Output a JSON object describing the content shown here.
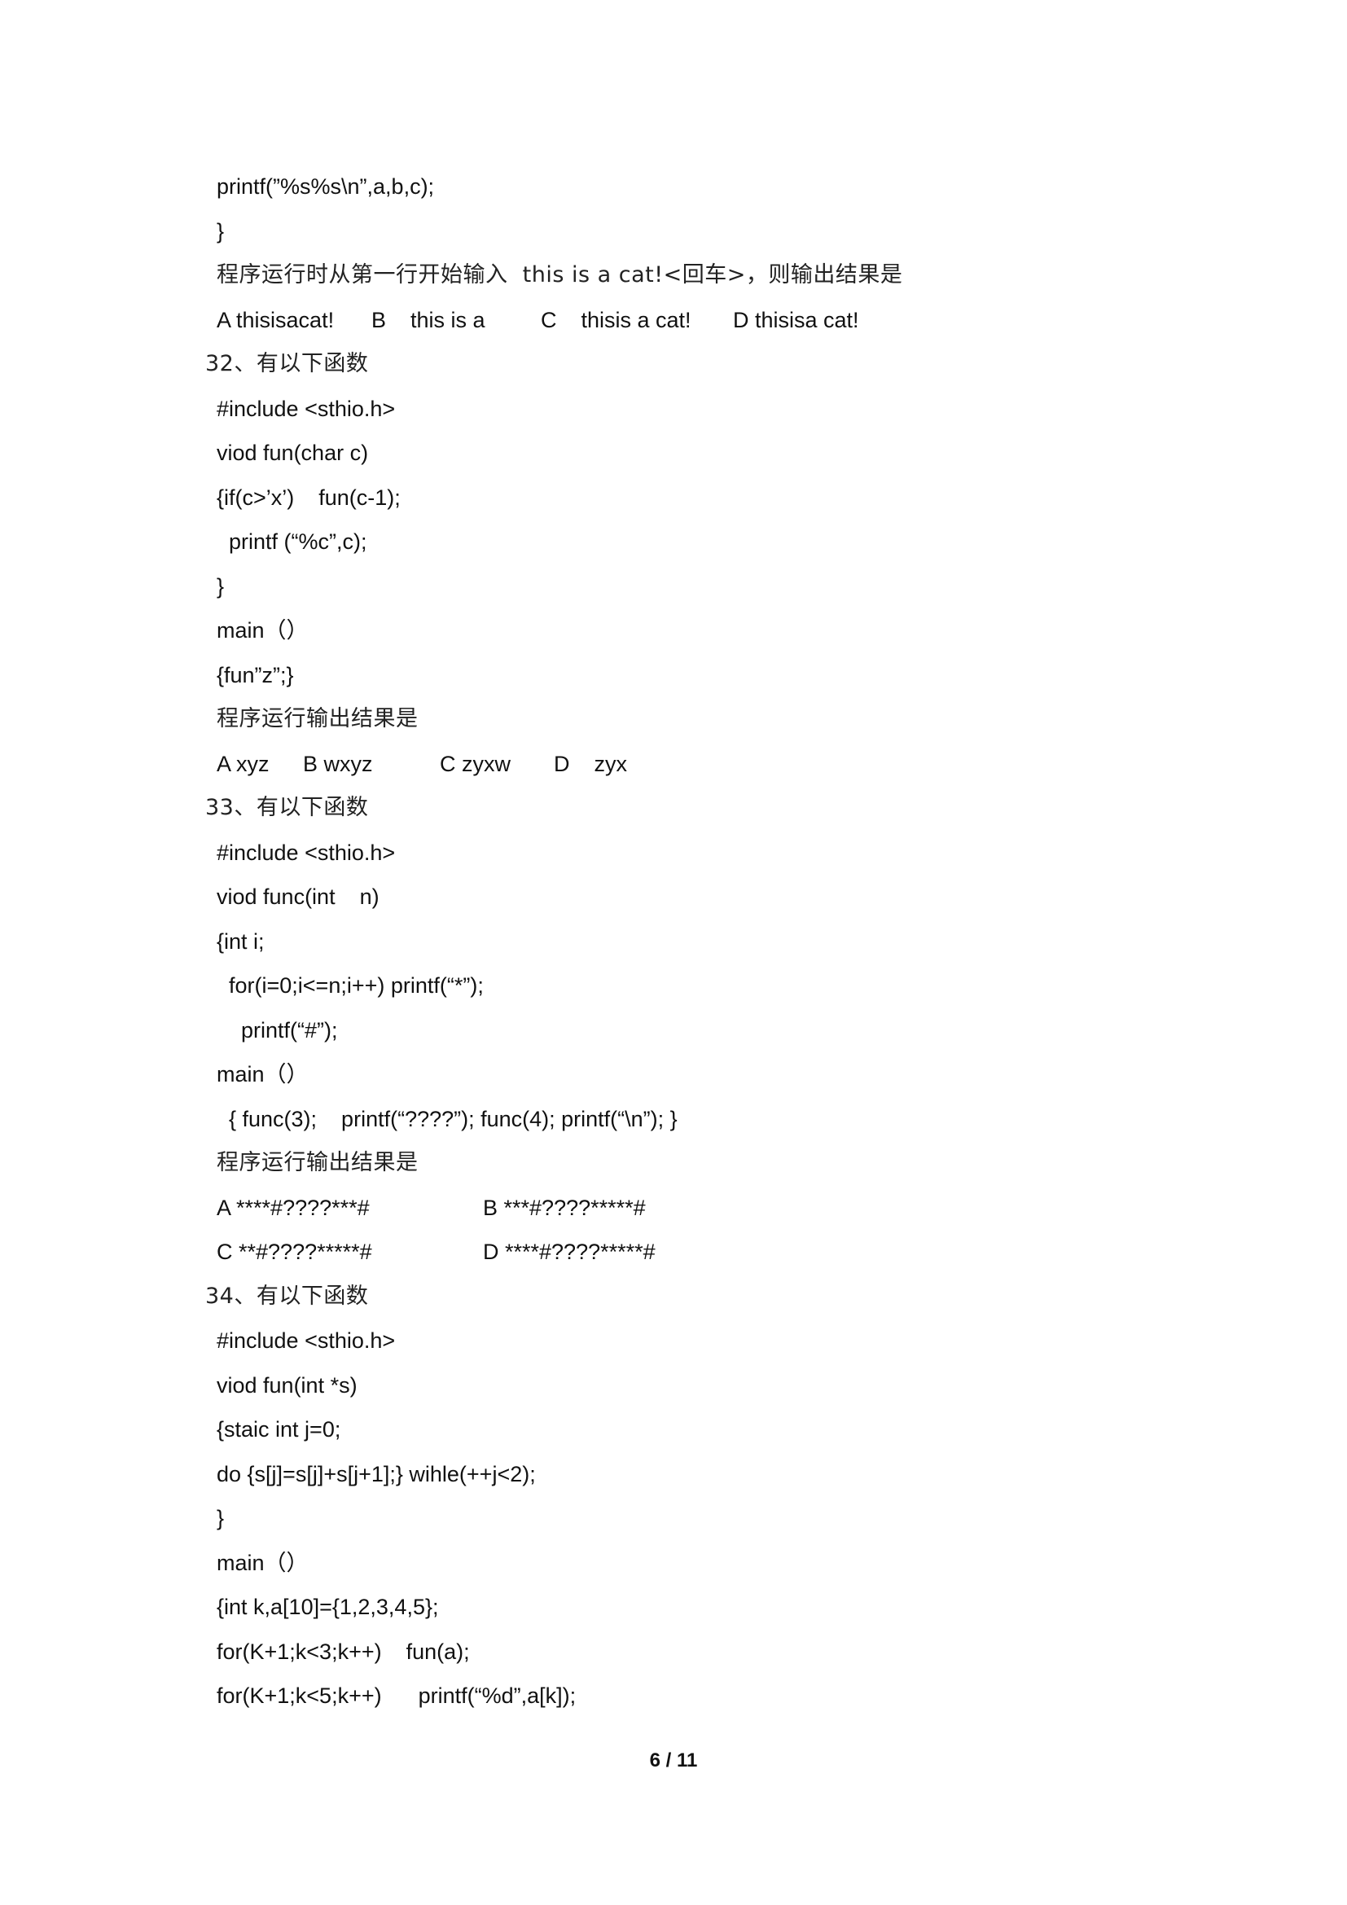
{
  "page": {
    "number_label": "6 / 11"
  },
  "lines": [
    {
      "text": "printf(”%s%s\\n”,a,b,c);"
    },
    {
      "text": "}"
    },
    {
      "text": "程序运行时从第一行开始输入  this is a cat!<回车>，则输出结果是"
    },
    {
      "options": [
        "A thisisacat!",
        "B    this is a",
        "C    thisis a cat!",
        "D thisisa cat!"
      ]
    },
    {
      "text": "32、有以下函数"
    },
    {
      "text": "#include <sthio.h>"
    },
    {
      "text": "viod fun(char c)"
    },
    {
      "text": "{if(c>’x’)    fun(c-1);"
    },
    {
      "text": "printf (“%c”,c);"
    },
    {
      "text": "}"
    },
    {
      "text": "main（）"
    },
    {
      "text": "{fun”z”;}"
    },
    {
      "text": "程序运行输出结果是"
    },
    {
      "options": [
        "A xyz",
        "B wxyz",
        "C zyxw",
        "D    zyx"
      ]
    },
    {
      "text": "33、有以下函数"
    },
    {
      "text": "#include <sthio.h>"
    },
    {
      "text": "viod func(int    n)"
    },
    {
      "text": "{int i;"
    },
    {
      "text": "for(i=0;i<=n;i++) printf(“*”);"
    },
    {
      "text": "printf(“#”);"
    },
    {
      "text": "main（）"
    },
    {
      "text": "{ func(3);    printf(“????”); func(4); printf(“\\n”); }"
    },
    {
      "text": "程序运行输出结果是"
    },
    {
      "options": [
        "A ****#????***#",
        "B ***#????*****#"
      ]
    },
    {
      "options": [
        "C **#????*****#",
        "D ****#????*****#"
      ]
    },
    {
      "text": "34、有以下函数"
    },
    {
      "text": "#include <sthio.h>"
    },
    {
      "text": "viod fun(int *s)"
    },
    {
      "text": "{staic int j=0;"
    },
    {
      "text": "do {s[j]=s[j]+s[j+1];} wihle(++j<2);"
    },
    {
      "text": "}"
    },
    {
      "text": "main（）"
    },
    {
      "text": "{int k,a[10]={1,2,3,4,5};"
    },
    {
      "text": "for(K+1;k<3;k++)    fun(a);"
    },
    {
      "text": "for(K+1;k<5;k++)      printf(“%d”,a[k]);"
    }
  ]
}
